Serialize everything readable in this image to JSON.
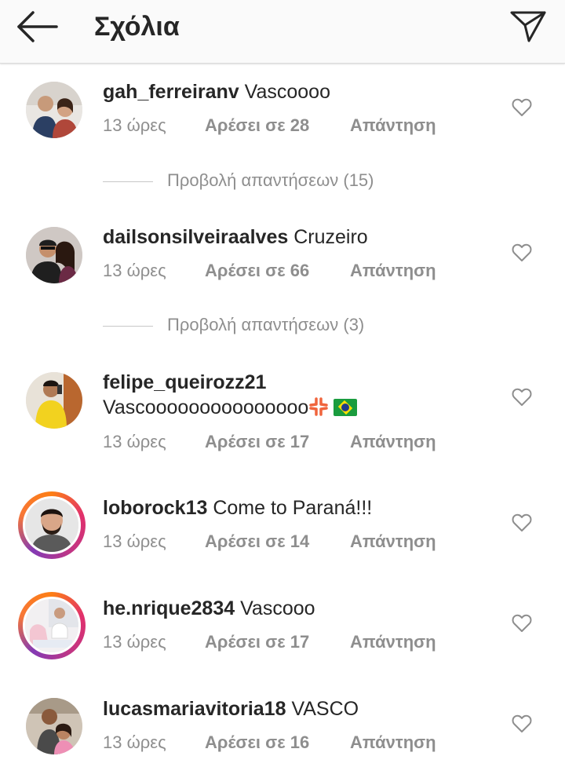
{
  "header": {
    "title": "Σχόλια",
    "back_icon": "arrow-left-icon",
    "send_icon": "paper-plane-icon"
  },
  "colors": {
    "header_bg": "#fafafa",
    "text": "#262626",
    "secondary_text": "#8e8e8e",
    "story_ring": "#e1306c"
  },
  "comments": [
    {
      "username": "gah_ferreiranv",
      "text": "Vascoooo",
      "time": "13 ώρες",
      "likes": "Αρέσει σε 28",
      "reply": "Απάντηση",
      "view_replies": "Προβολή απαντήσεων (15)"
    },
    {
      "username": "dailsonsilveiraalves",
      "text": "Cruzeiro",
      "time": "13 ώρες",
      "likes": "Αρέσει σε 66",
      "reply": "Απάντηση",
      "view_replies": "Προβολή απαντήσεων (3)"
    },
    {
      "username": "felipe_queirozz21",
      "text": "Vascooooooooooooooo",
      "time": "13 ώρες",
      "likes": "Αρέσει σε 17",
      "reply": "Απάντηση"
    },
    {
      "username": "loborock13",
      "text": "Come to Paraná!!!",
      "time": "13 ώρες",
      "likes": "Αρέσει σε 14",
      "reply": "Απάντηση"
    },
    {
      "username": "he.nrique2834",
      "text": "Vascooo",
      "time": "13 ώρες",
      "likes": "Αρέσει σε 17",
      "reply": "Απάντηση"
    },
    {
      "username": "lucasmariavitoria18",
      "text": "VASCO",
      "time": "13 ώρες",
      "likes": "Αρέσει σε 16",
      "reply": "Απάντηση"
    }
  ]
}
